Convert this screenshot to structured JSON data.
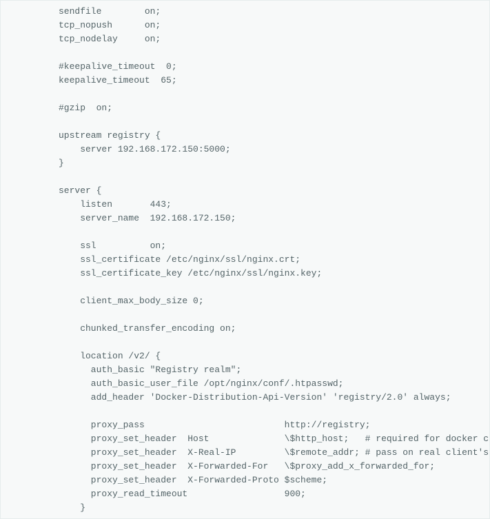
{
  "code": {
    "lines": [
      "sendfile        on;",
      "tcp_nopush      on;",
      "tcp_nodelay     on;",
      "",
      "#keepalive_timeout  0;",
      "keepalive_timeout  65;",
      "",
      "#gzip  on;",
      "",
      "upstream registry {",
      "    server 192.168.172.150:5000;",
      "}",
      "",
      "server {",
      "    listen       443;",
      "    server_name  192.168.172.150;",
      "",
      "    ssl          on;",
      "    ssl_certificate /etc/nginx/ssl/nginx.crt;",
      "    ssl_certificate_key /etc/nginx/ssl/nginx.key;",
      "",
      "    client_max_body_size 0;",
      "",
      "    chunked_transfer_encoding on;",
      "",
      "    location /v2/ {",
      "      auth_basic \"Registry realm\";",
      "      auth_basic_user_file /opt/nginx/conf/.htpasswd;",
      "      add_header 'Docker-Distribution-Api-Version' 'registry/2.0' always;",
      "",
      "      proxy_pass                          http://registry;",
      "      proxy_set_header  Host              \\$http_host;   # required for docker c",
      "      proxy_set_header  X-Real-IP         \\$remote_addr; # pass on real client's",
      "      proxy_set_header  X-Forwarded-For   \\$proxy_add_x_forwarded_for;",
      "      proxy_set_header  X-Forwarded-Proto $scheme;",
      "      proxy_read_timeout                  900;",
      "    }"
    ]
  }
}
